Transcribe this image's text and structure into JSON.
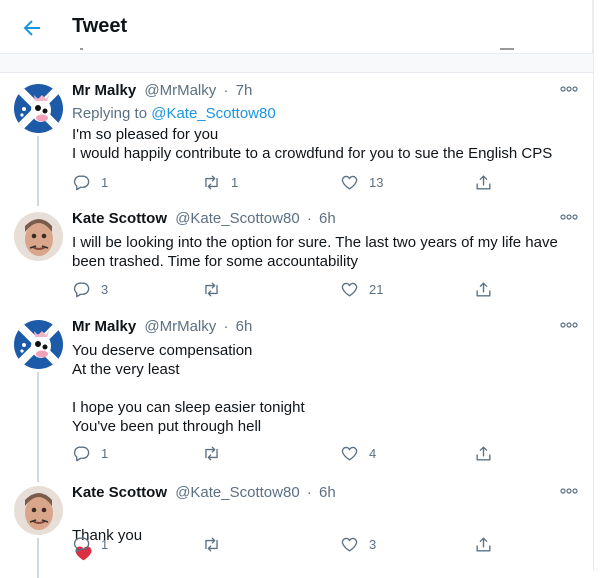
{
  "header": {
    "title": "Tweet"
  },
  "tweets": [
    {
      "name": "Mr Malky",
      "handle": "@MrMalky",
      "time": "7h",
      "reply_prefix": "Replying to ",
      "reply_to": "@Kate_Scottow80",
      "text": "I'm so pleased for you\nI would happily contribute to a crowdfund for you to sue the English CPS",
      "replies": "1",
      "retweets": "1",
      "likes": "13",
      "avatar": "cow-saltire-avatar"
    },
    {
      "name": "Kate Scottow",
      "handle": "@Kate_Scottow80",
      "time": "6h",
      "text": "I will be looking into the option for sure. The last two years of my life have\nbeen trashed. Time for some accountability",
      "replies": "3",
      "retweets": "",
      "likes": "21",
      "avatar": "kate-photo-avatar"
    },
    {
      "name": "Mr Malky",
      "handle": "@MrMalky",
      "time": "6h",
      "text": "You deserve compensation\nAt the very least\n\nI hope you can sleep easier tonight\nYou've been put through hell",
      "replies": "1",
      "retweets": "",
      "likes": "4",
      "avatar": "cow-saltire-avatar"
    },
    {
      "name": "Kate Scottow",
      "handle": "@Kate_Scottow80",
      "time": "6h",
      "text": "Thank you",
      "emoji": "heart-emoji",
      "replies": "1",
      "retweets": "",
      "likes": "3",
      "avatar": "kate-photo-avatar"
    }
  ],
  "dot_separator": "·",
  "colors": {
    "accent": "#1b95e0",
    "muted": "#5b7083",
    "heart": "#e0245e",
    "divider": "#e6ecf0"
  }
}
